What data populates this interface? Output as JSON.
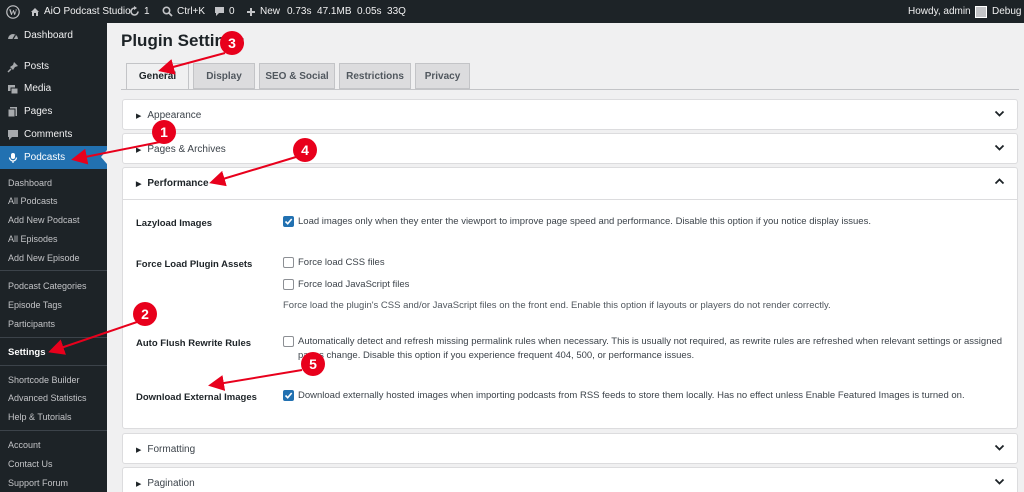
{
  "admin_bar": {
    "site_name": "AiO Podcast Studio",
    "updates_count": "1",
    "search_shortcut": "Ctrl+K",
    "comments_count": "0",
    "new_label": "New",
    "perf_stats": "0.73s  47.1MB  0.05s  33Q",
    "howdy": "Howdy, admin",
    "debug": "Debug"
  },
  "sidebar": {
    "menu": [
      {
        "label": "Dashboard",
        "icon": "dashboard-icon"
      },
      {
        "label": "Posts",
        "icon": "pin-icon"
      },
      {
        "label": "Media",
        "icon": "media-icon"
      },
      {
        "label": "Pages",
        "icon": "pages-icon"
      },
      {
        "label": "Comments",
        "icon": "comment-icon"
      },
      {
        "label": "Podcasts",
        "icon": "microphone-icon"
      }
    ],
    "submenu": [
      "Dashboard",
      "All Podcasts",
      "Add New Podcast",
      "All Episodes",
      "Add New Episode",
      "Podcast Categories",
      "Episode Tags",
      "Participants",
      "Settings",
      "Shortcode Builder",
      "Advanced Statistics",
      "Help & Tutorials",
      "Account",
      "Contact Us",
      "Support Forum"
    ]
  },
  "page": {
    "title": "Plugin Settings",
    "tabs": [
      "General",
      "Display",
      "SEO & Social",
      "Restrictions",
      "Privacy"
    ]
  },
  "sections": {
    "appearance": "Appearance",
    "pages_archives": "Pages & Archives",
    "performance": "Performance",
    "formatting": "Formatting",
    "pagination": "Pagination"
  },
  "performance": {
    "lazyload_label": "Lazyload Images",
    "lazyload_text": "Load images only when they enter the viewport to improve page speed and performance. Disable this option if you notice display issues.",
    "force_label": "Force Load Plugin Assets",
    "force_css": "Force load CSS files",
    "force_js": "Force load JavaScript files",
    "force_desc": "Force load the plugin's CSS and/or JavaScript files on the front end. Enable this option if layouts or players do not render correctly.",
    "flush_label": "Auto Flush Rewrite Rules",
    "flush_text": "Automatically detect and refresh missing permalink rules when necessary. This is usually not required, as rewrite rules are refreshed when relevant settings or assigned pages change. Disable this option if you experience frequent 404, 500, or performance issues.",
    "download_label": "Download External Images",
    "download_text": "Download externally hosted images when importing podcasts from RSS feeds to store them locally. Has no effect unless Enable Featured Images is turned on."
  },
  "annotations": [
    "1",
    "2",
    "3",
    "4",
    "5"
  ],
  "colors": {
    "accent": "#2271b1",
    "annotation": "#e8001c",
    "admin_dark": "#1d2327"
  }
}
